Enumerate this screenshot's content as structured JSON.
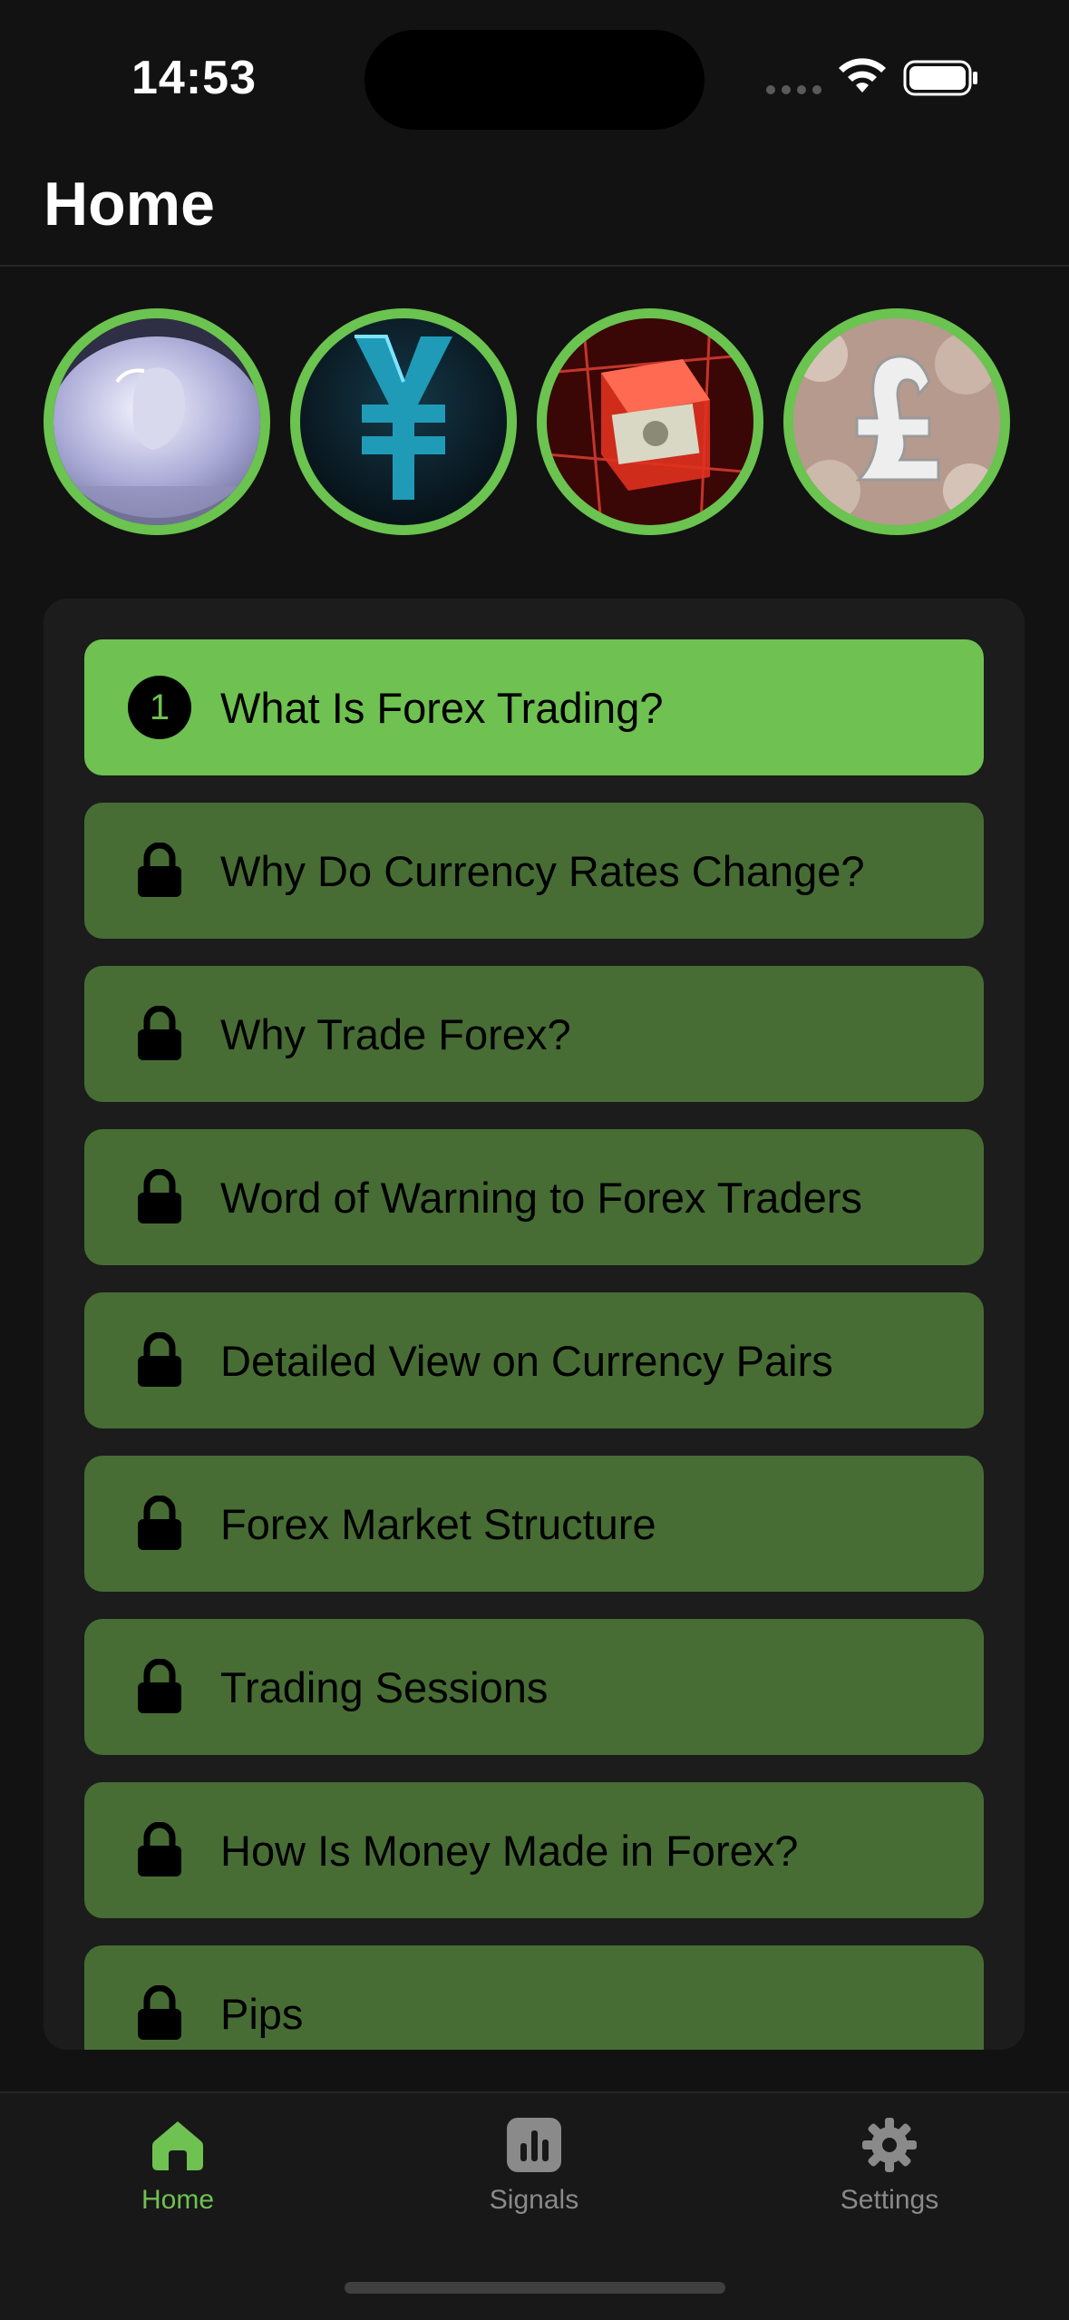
{
  "status_bar": {
    "time": "14:53"
  },
  "header": {
    "title": "Home"
  },
  "stories": [
    {
      "name": "silver-coin-story",
      "accent": "#6bc350"
    },
    {
      "name": "yen-story",
      "accent": "#6bc350"
    },
    {
      "name": "dollar-cube-story",
      "accent": "#6bc350"
    },
    {
      "name": "pound-story",
      "accent": "#6bc350"
    }
  ],
  "lessons": {
    "items": [
      {
        "label": "What Is Forex Trading?",
        "badge": "1",
        "locked": false
      },
      {
        "label": "Why Do Currency Rates Change?",
        "locked": true
      },
      {
        "label": "Why Trade Forex?",
        "locked": true
      },
      {
        "label": "Word of Warning to Forex Traders",
        "locked": true
      },
      {
        "label": "Detailed View on Currency Pairs",
        "locked": true
      },
      {
        "label": "Forex Market Structure",
        "locked": true
      },
      {
        "label": "Trading Sessions",
        "locked": true
      },
      {
        "label": "How Is Money Made in Forex?",
        "locked": true
      },
      {
        "label": "Pips",
        "locked": true
      }
    ]
  },
  "tab_bar": {
    "tabs": [
      {
        "label": "Home",
        "icon": "home-icon",
        "active": true
      },
      {
        "label": "Signals",
        "icon": "chart-icon",
        "active": false
      },
      {
        "label": "Settings",
        "icon": "gear-icon",
        "active": false
      }
    ]
  },
  "colors": {
    "accent": "#6fc151",
    "lesson_locked": "#476d34",
    "background": "#121212",
    "panel": "#1c1c1c"
  }
}
